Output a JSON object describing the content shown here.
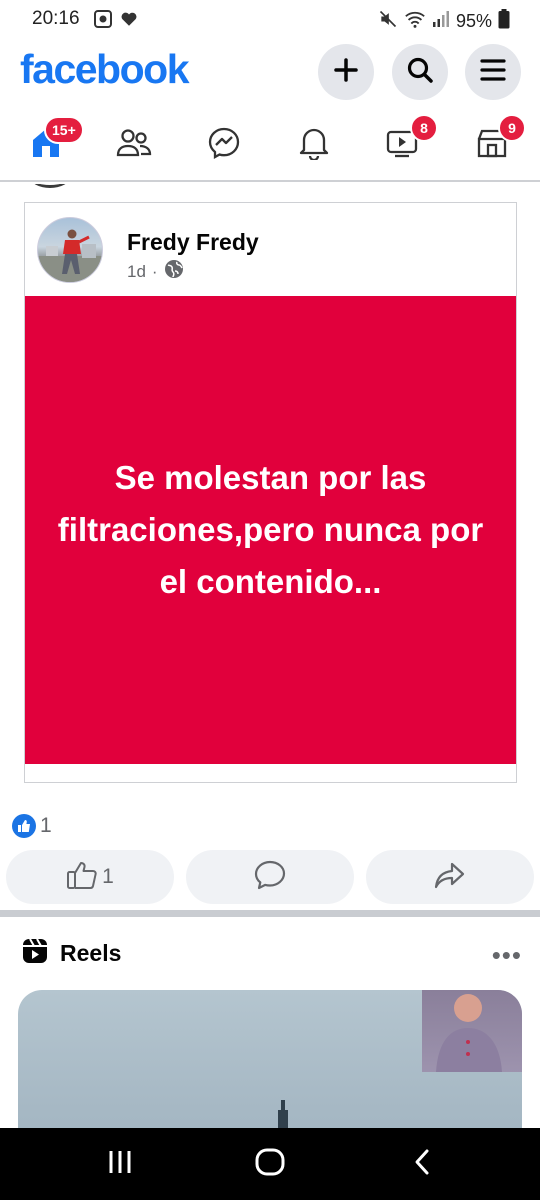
{
  "status_bar": {
    "time": "20:16",
    "battery": "95%"
  },
  "header": {
    "logo": "facebook",
    "brand_color": "#1877f2",
    "buttons": [
      {
        "icon": "plus-icon"
      },
      {
        "icon": "search-icon"
      },
      {
        "icon": "menu-icon"
      }
    ]
  },
  "nav": {
    "tabs": [
      {
        "name": "home",
        "icon": "home-icon",
        "badge": "15+",
        "active": true
      },
      {
        "name": "friends",
        "icon": "friends-icon",
        "badge": ""
      },
      {
        "name": "messenger",
        "icon": "messenger-icon",
        "badge": ""
      },
      {
        "name": "notifications",
        "icon": "bell-icon",
        "badge": ""
      },
      {
        "name": "video",
        "icon": "video-icon",
        "badge": "8"
      },
      {
        "name": "marketplace",
        "icon": "marketplace-icon",
        "badge": "9"
      }
    ],
    "badge_color": "#e41e3f"
  },
  "post": {
    "author": "Fredy Fredy",
    "time": "1d",
    "separator": "·",
    "quote": "Se molestan por las filtraciones,pero nunca por el contenido...",
    "background_color": "#e1003c",
    "reaction_count": "1",
    "actions": {
      "like_count": "1"
    }
  },
  "reels": {
    "title": "Reels",
    "more": "•••"
  }
}
